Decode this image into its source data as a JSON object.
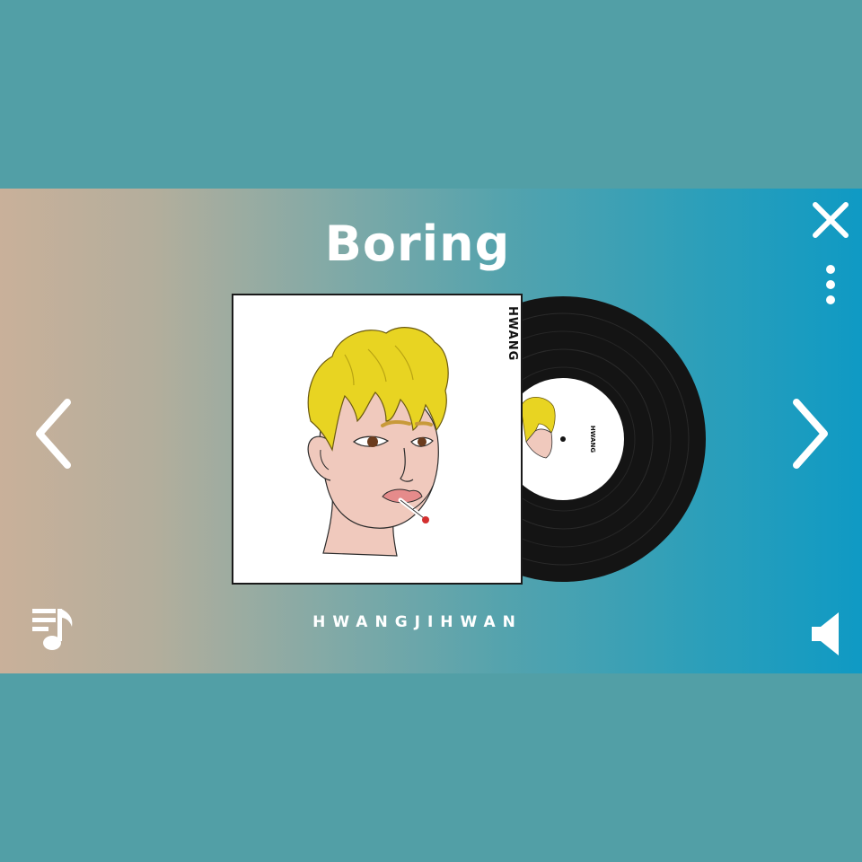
{
  "track": {
    "title": "Boring",
    "artist": "HWANGJIHWAN"
  },
  "album": {
    "cover_text": "HWANG",
    "record_label_text": "HWANG"
  },
  "controls": {
    "close_icon": "close-icon",
    "more_icon": "vertical-dots-icon",
    "prev_icon": "chevron-left-icon",
    "next_icon": "chevron-right-icon",
    "playlist_icon": "playlist-music-icon",
    "volume_icon": "speaker-icon"
  },
  "colors": {
    "background": "#529fa6",
    "gradient_left": "#c9b09a",
    "gradient_right": "#0f9ac4",
    "text": "#ffffff",
    "hair": "#e8d422",
    "skin": "#f0c9bd",
    "vinyl": "#141414"
  }
}
